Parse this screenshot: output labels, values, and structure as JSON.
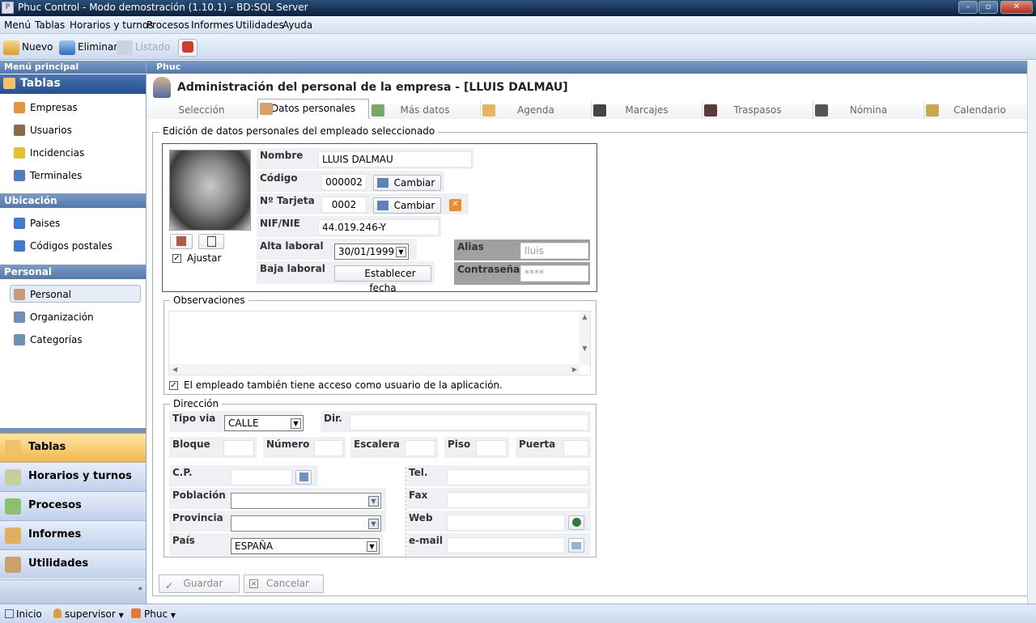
{
  "window": {
    "title": "Phuc Control - Modo demostración (1.10.1) - BD:SQL Server"
  },
  "menu": [
    "Menú",
    "Tablas",
    "Horarios y turnos",
    "Procesos",
    "Informes",
    "Utilidades",
    "Ayuda"
  ],
  "toolbar": {
    "new_label": "Nuevo",
    "delete_label": "Eliminar",
    "list_label": "Listado"
  },
  "left": {
    "header": "Menú principal",
    "tablas_title": "Tablas",
    "tablas_items": [
      "Empresas",
      "Usuarios",
      "Incidencias",
      "Terminales"
    ],
    "ubicacion_title": "Ubicación",
    "ubicacion_items": [
      "Paises",
      "Códigos postales"
    ],
    "personal_title": "Personal",
    "personal_items": [
      "Personal",
      "Organización",
      "Categorías"
    ],
    "nav": [
      "Tablas",
      "Horarios y turnos",
      "Procesos",
      "Informes",
      "Utilidades"
    ]
  },
  "main": {
    "header": "Phuc",
    "title": "Administración del personal de la empresa - [LLUIS DALMAU]",
    "tabs": [
      "Selección",
      "Datos personales",
      "Más datos",
      "Agenda",
      "Marcajes",
      "Traspasos",
      "Nómina",
      "Calendario"
    ],
    "section_title": "Edición de datos personales del empleado seleccionado",
    "labels": {
      "nombre": "Nombre",
      "codigo": "Código",
      "tarjeta": "Nº Tarjeta",
      "nif": "NIF/NIE",
      "alta": "Alta laboral",
      "baja": "Baja laboral",
      "alias": "Alias",
      "password": "Contraseña",
      "ajustar": "Ajustar",
      "cambiar": "Cambiar",
      "establecer": "Establecer fecha"
    },
    "values": {
      "nombre": "LLUIS DALMAU",
      "codigo": "000002",
      "tarjeta": "0002",
      "nif": "44.019.246-Y",
      "alta": "30/01/1999",
      "alias": "lluis",
      "password": "****"
    },
    "observaciones_title": "Observaciones",
    "acceso_label": "El empleado también tiene acceso como usuario de la aplicación.",
    "direccion_title": "Dirección",
    "dir_labels": {
      "tipo": "Tipo via",
      "dir": "Dir.",
      "bloque": "Bloque",
      "numero": "Número",
      "escalera": "Escalera",
      "piso": "Piso",
      "puerta": "Puerta",
      "cp": "C.P.",
      "poblacion": "Población",
      "provincia": "Provincia",
      "pais": "País",
      "tel": "Tel.",
      "fax": "Fax",
      "web": "Web",
      "email": "e-mail"
    },
    "dir_values": {
      "tipo": "CALLE",
      "pais": "ESPAÑA"
    },
    "guardar": "Guardar",
    "cancelar": "Cancelar"
  },
  "status": {
    "inicio": "Inicio",
    "user": "supervisor",
    "app": "Phuc"
  }
}
